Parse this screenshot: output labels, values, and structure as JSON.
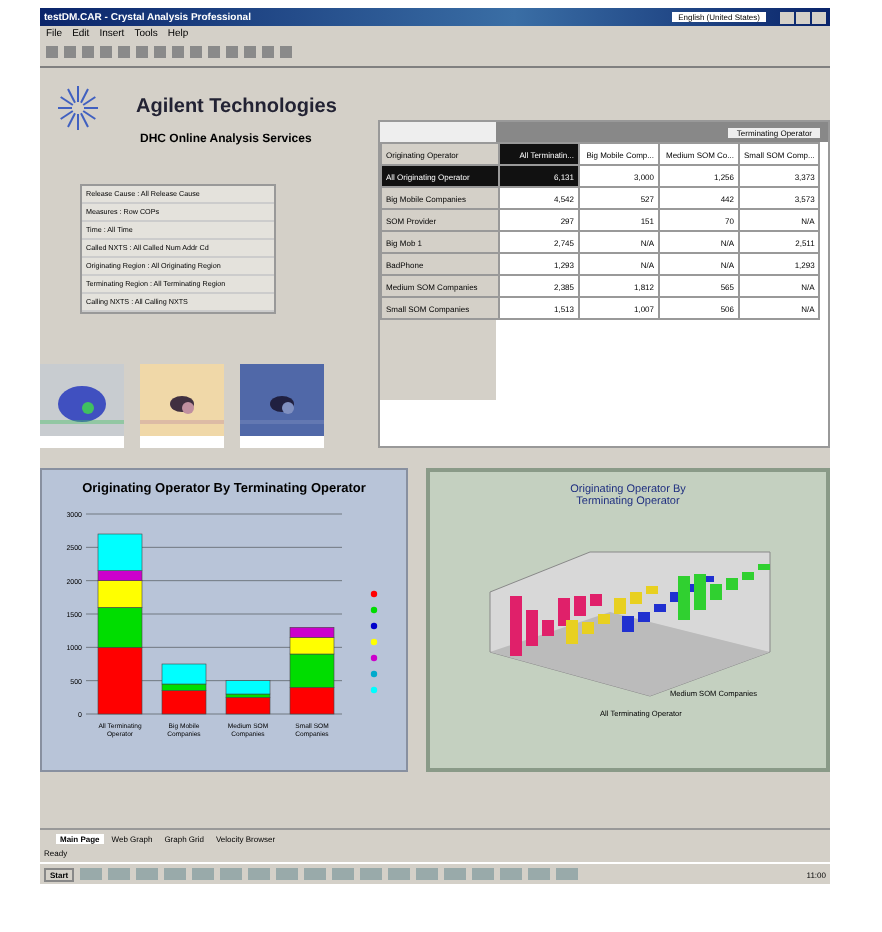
{
  "window": {
    "title": "testDM.CAR - Crystal Analysis Professional",
    "language": "English (United States)"
  },
  "menu": [
    "File",
    "Edit",
    "Insert",
    "Tools",
    "Help"
  ],
  "header": {
    "company": "Agilent Technologies",
    "subtitle": "DHC Online Analysis Services"
  },
  "filters": [
    "Release Cause : All Release Cause",
    "Measures : Row COPs",
    "Time : All Time",
    "Called NXTS : All Called Num Addr Cd",
    "Originating Region : All Originating Region",
    "Terminating Region : All Terminating Region",
    "Calling NXTS : All Calling NXTS"
  ],
  "crosstab": {
    "dimension": "Terminating Operator",
    "row_header": "Originating Operator",
    "columns": [
      {
        "label": "All Terminatin...",
        "selected": true
      },
      {
        "label": "Big Mobile Comp...",
        "selected": false
      },
      {
        "label": "Medium SOM Co...",
        "selected": false
      },
      {
        "label": "Small SOM Comp...",
        "selected": false
      }
    ],
    "rows": [
      {
        "label": "All Originating Operator",
        "selected": true,
        "values": [
          "6,131",
          "3,000",
          "1,256",
          "3,373"
        ]
      },
      {
        "label": "Big Mobile Companies",
        "selected": false,
        "values": [
          "4,542",
          "527",
          "442",
          "3,573"
        ]
      },
      {
        "label": "SOM Provider",
        "selected": false,
        "values": [
          "297",
          "151",
          "70",
          "N/A"
        ]
      },
      {
        "label": "Big Mob 1",
        "selected": false,
        "values": [
          "2,745",
          "N/A",
          "N/A",
          "2,511"
        ]
      },
      {
        "label": "BadPhone",
        "selected": false,
        "values": [
          "1,293",
          "N/A",
          "N/A",
          "1,293"
        ]
      },
      {
        "label": "Medium SOM Companies",
        "selected": false,
        "values": [
          "2,385",
          "1,812",
          "565",
          "N/A"
        ]
      },
      {
        "label": "Small SOM Companies",
        "selected": false,
        "values": [
          "1,513",
          "1,007",
          "506",
          "N/A"
        ]
      }
    ]
  },
  "bar_chart": {
    "chart_data": {
      "type": "bar",
      "stacked": true,
      "title": "Originating Operator By Terminating Operator",
      "categories": [
        "All Terminating Operator",
        "Big Mobile Companies",
        "Medium SOM Companies",
        "Small SOM Companies"
      ],
      "ylim": [
        0,
        3000
      ],
      "grid": true,
      "yticks": [
        0,
        500,
        1000,
        1500,
        2000,
        2500,
        3000
      ],
      "series": [
        {
          "color": "#ff0000",
          "values": [
            1000,
            350,
            250,
            400
          ]
        },
        {
          "color": "#00dd00",
          "values": [
            600,
            100,
            50,
            500
          ]
        },
        {
          "color": "#0000cc",
          "values": [
            0,
            0,
            0,
            0
          ]
        },
        {
          "color": "#ffff00",
          "values": [
            400,
            0,
            0,
            250
          ]
        },
        {
          "color": "#cc00cc",
          "values": [
            150,
            0,
            0,
            150
          ]
        },
        {
          "color": "#00aacc",
          "values": [
            0,
            0,
            0,
            0
          ]
        },
        {
          "color": "#00ffff",
          "values": [
            550,
            300,
            200,
            0
          ]
        }
      ]
    }
  },
  "chart_3d": {
    "title": "Originating Operator By Terminating Operator",
    "axis_labels": [
      "Medium SOM Companies",
      "All Terminating Operator"
    ]
  },
  "sheet_tabs": [
    {
      "label": "Main Page",
      "selected": true
    },
    {
      "label": "Web Graph",
      "selected": false
    },
    {
      "label": "Graph Grid",
      "selected": false
    },
    {
      "label": "Velocity Browser",
      "selected": false
    }
  ],
  "status_bar": "Ready",
  "taskbar": {
    "start": "Start",
    "clock": "11:00"
  }
}
